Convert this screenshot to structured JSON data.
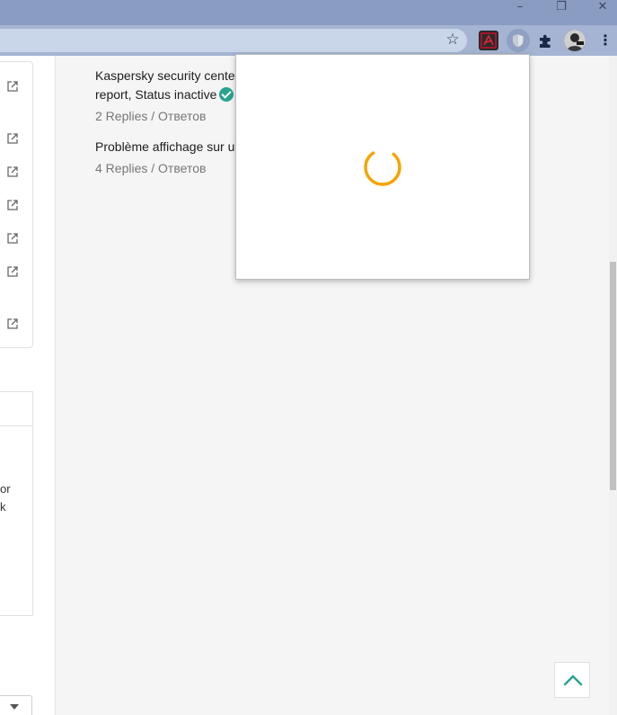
{
  "window_controls": {
    "minimize": "–",
    "restore": "❐",
    "close": "✕"
  },
  "toolbar": {
    "star_icon": "star-icon",
    "extensions": [
      "pdf-icon",
      "shield-icon",
      "puzzle-icon",
      "avatar"
    ],
    "menu": "⋮"
  },
  "topics": [
    {
      "title_line1": "Kaspersky security center",
      "title_line2": "report, Status inactive",
      "solved": true,
      "meta": "2 Replies / Ответов"
    },
    {
      "title_line1": "Problème affichage sur u",
      "meta": "4 Replies / Ответов"
    }
  ],
  "left_fragments": [
    "or",
    "k"
  ],
  "colors": {
    "accent": "#29a38f",
    "spinner": "#f5a400",
    "titlebar": "#8a9cc2"
  }
}
